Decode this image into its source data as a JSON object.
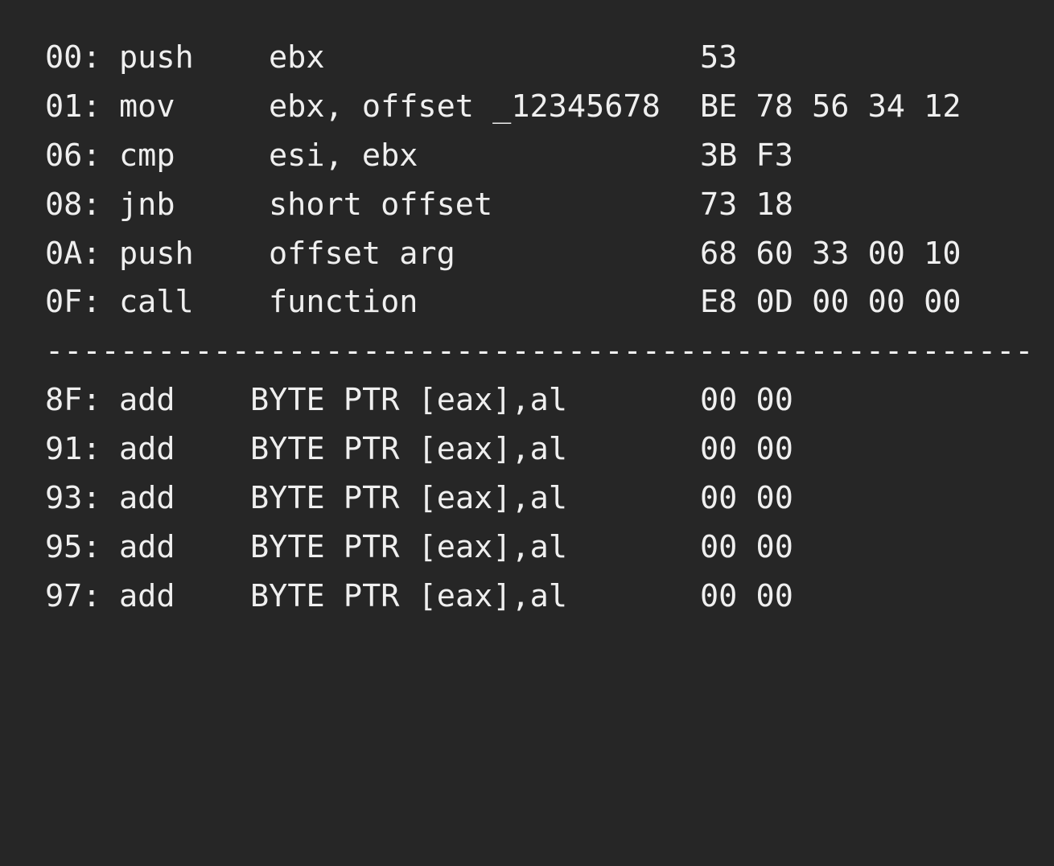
{
  "listing": {
    "upper": [
      {
        "addr": "00:",
        "mnemonic": "push",
        "operands": "ebx",
        "bytes": "53"
      },
      {
        "addr": "01:",
        "mnemonic": "mov",
        "operands": "ebx, offset _12345678",
        "bytes": "BE 78 56 34 12"
      },
      {
        "addr": "06:",
        "mnemonic": "cmp",
        "operands": "esi, ebx",
        "bytes": "3B F3"
      },
      {
        "addr": "08:",
        "mnemonic": "jnb",
        "operands": "short offset",
        "bytes": "73 18"
      },
      {
        "addr": "0A:",
        "mnemonic": "push",
        "operands": "offset arg",
        "bytes": "68 60 33 00 10"
      },
      {
        "addr": "0F:",
        "mnemonic": "call",
        "operands": "function",
        "bytes": "E8 0D 00 00 00"
      }
    ],
    "separator": "-----------------------------------------------------",
    "lower": [
      {
        "addr": "8F:",
        "mnemonic": "add",
        "operands": "BYTE PTR [eax],al",
        "bytes": "00 00"
      },
      {
        "addr": "91:",
        "mnemonic": "add",
        "operands": "BYTE PTR [eax],al",
        "bytes": "00 00"
      },
      {
        "addr": "93:",
        "mnemonic": "add",
        "operands": "BYTE PTR [eax],al",
        "bytes": "00 00"
      },
      {
        "addr": "95:",
        "mnemonic": "add",
        "operands": "BYTE PTR [eax],al",
        "bytes": "00 00"
      },
      {
        "addr": "97:",
        "mnemonic": "add",
        "operands": "BYTE PTR [eax],al",
        "bytes": "00 00"
      }
    ]
  },
  "colors": {
    "background": "#262626",
    "text": "#efefef"
  }
}
